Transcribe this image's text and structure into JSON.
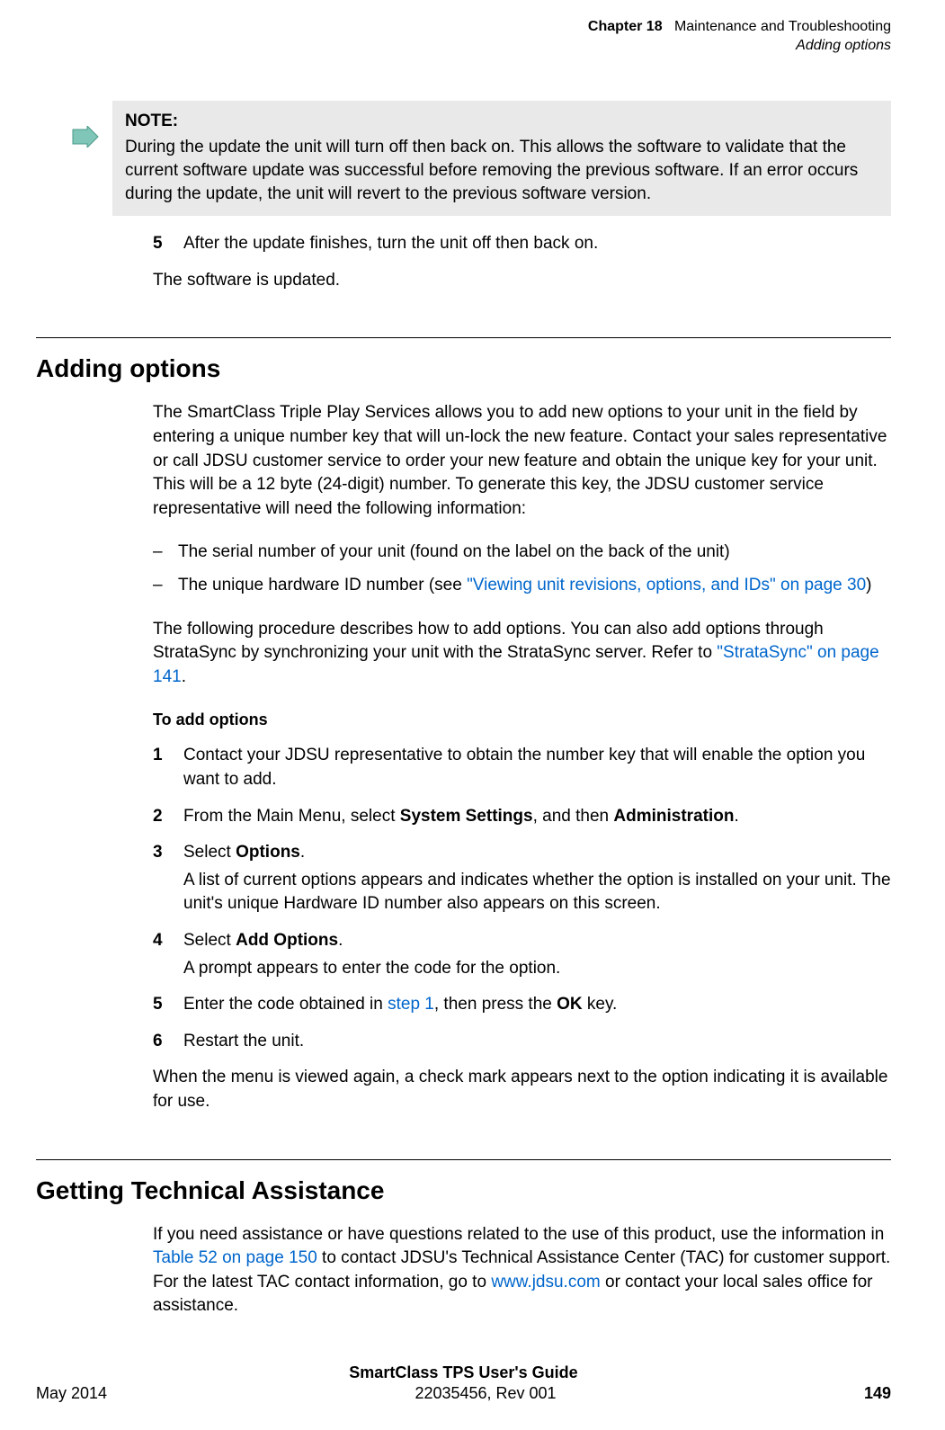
{
  "header": {
    "chapter_prefix": "Chapter 18",
    "chapter_title": "Maintenance and Troubleshooting",
    "section_title": "Adding options"
  },
  "note": {
    "heading": "NOTE:",
    "body": "During the update the unit will turn off then back on. This allows the software to validate that the current software update was successful before removing the previous software. If an error occurs during the update, the unit will revert to the previous software version."
  },
  "topstep": {
    "num": "5",
    "text": "After the update finishes, turn the unit off then back on."
  },
  "topclosing": "The software is updated.",
  "adding": {
    "title": "Adding options",
    "intro": "The SmartClass Triple Play Services allows you to add new options to your unit in the field by entering a unique number key that will un-lock the new feature. Contact your sales representative or call JDSU customer service to order your new feature and obtain the unique key for your unit. This will be a 12 byte (24-digit) number. To generate this key, the JDSU customer service representative will need the following information:",
    "bullets": {
      "b1": "The serial number of your unit (found on the label on the back of the unit)",
      "b2_pre": "The unique hardware ID number (see ",
      "b2_link": "\"Viewing unit revisions, options, and IDs\" on page 30",
      "b2_post": ")"
    },
    "follow_pre": "The following procedure describes how to add options. You can also add options through StrataSync by synchronizing your unit with the StrataSync server. Refer to ",
    "follow_link": "\"StrataSync\" on page 141",
    "follow_post": ".",
    "subhead": "To add options",
    "steps": {
      "s1": {
        "num": "1",
        "text": "Contact your JDSU representative to obtain the number key that will enable the option you want to add."
      },
      "s2": {
        "num": "2",
        "pre": "From the Main Menu, select ",
        "b1": "System Settings",
        "mid": ", and then ",
        "b2": "Administration",
        "post": "."
      },
      "s3": {
        "num": "3",
        "pre": "Select ",
        "b1": "Options",
        "post": ".",
        "sub": "A list of current options appears and indicates whether the option is installed on your unit. The unit's unique Hardware ID number also appears on this screen."
      },
      "s4": {
        "num": "4",
        "pre": "Select ",
        "b1": "Add Options",
        "post": ".",
        "sub": "A prompt appears to enter the code for the option."
      },
      "s5": {
        "num": "5",
        "pre": "Enter the code obtained in ",
        "link": "step 1",
        "mid": ", then press the ",
        "b1": "OK",
        "post": " key."
      },
      "s6": {
        "num": "6",
        "text": "Restart the unit."
      }
    },
    "closing": "When the menu is viewed again, a check mark appears next to the option indicating it is available for use."
  },
  "getting": {
    "title": "Getting Technical Assistance",
    "pre": "If you need assistance or have questions related to the use of this product, use the information in ",
    "link1": "Table 52 on page 150",
    "mid1": " to contact JDSU's Technical Assistance Center (TAC) for customer support. For the latest TAC contact information, go to ",
    "link2": "www.jdsu.com",
    "post": " or contact your local sales office for assistance."
  },
  "footer": {
    "title": "SmartClass TPS User's Guide",
    "left": "May 2014",
    "center": "22035456, Rev 001",
    "right": "149"
  }
}
